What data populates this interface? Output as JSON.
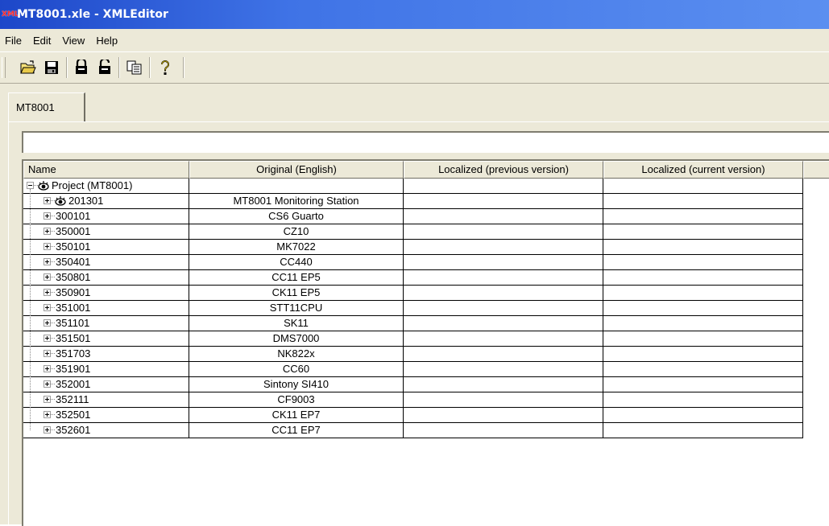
{
  "window": {
    "title": "MT8001.xle - XMLEditor",
    "app_icon_text": "XML"
  },
  "menu": {
    "items": [
      "File",
      "Edit",
      "View",
      "Help"
    ]
  },
  "toolbar": {
    "buttons": [
      {
        "icon": "open-folder-icon",
        "label": "Open"
      },
      {
        "icon": "save-icon",
        "label": "Save"
      },
      {
        "icon": "import-icon",
        "label": "Import"
      },
      {
        "icon": "export-icon",
        "label": "Export"
      },
      {
        "icon": "copy-icon",
        "label": "Copy"
      },
      {
        "icon": "help-icon",
        "label": "Help"
      }
    ]
  },
  "tabs": [
    {
      "label": "MT8001"
    }
  ],
  "path_field": {
    "value": ""
  },
  "grid": {
    "columns": [
      "Name",
      "Original (English)",
      "Localized (previous version)",
      "Localized (current version)"
    ],
    "root": {
      "name": "Project (MT8001)",
      "icon": "eye-icon",
      "expander": "minus"
    },
    "rows": [
      {
        "name": "201301",
        "original": "MT8001 Monitoring Station",
        "icon": "eye-icon"
      },
      {
        "name": "300101",
        "original": "CS6 Guarto"
      },
      {
        "name": "350001",
        "original": "CZ10"
      },
      {
        "name": "350101",
        "original": "MK7022"
      },
      {
        "name": "350401",
        "original": "CC440"
      },
      {
        "name": "350801",
        "original": "CC11 EP5"
      },
      {
        "name": "350901",
        "original": "CK11 EP5"
      },
      {
        "name": "351001",
        "original": "STT11CPU"
      },
      {
        "name": "351101",
        "original": "SK11"
      },
      {
        "name": "351501",
        "original": "DMS7000"
      },
      {
        "name": "351703",
        "original": "NK822x"
      },
      {
        "name": "351901",
        "original": "CC60"
      },
      {
        "name": "352001",
        "original": "Sintony SI410"
      },
      {
        "name": "352111",
        "original": "CF9003"
      },
      {
        "name": "352501",
        "original": "CK11 EP7"
      },
      {
        "name": "352601",
        "original": "CC11 EP7"
      }
    ]
  }
}
